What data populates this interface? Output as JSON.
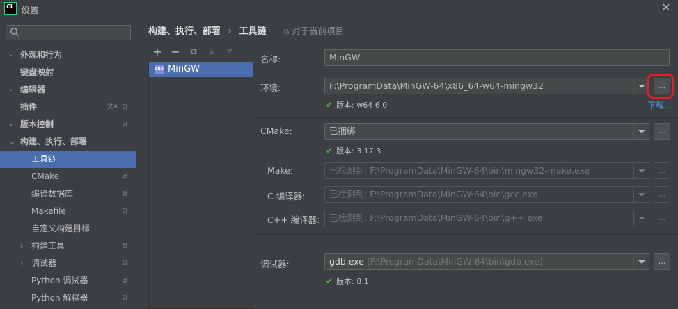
{
  "window": {
    "title": "设置",
    "app_logo": "CL",
    "close_icon": "✕"
  },
  "sidebar": {
    "search_placeholder": "",
    "items": [
      {
        "label": "外观和行为",
        "level": 0,
        "chevron": "›",
        "bold": true
      },
      {
        "label": "键盘映射",
        "level": 0,
        "chevron": "",
        "bold": true
      },
      {
        "label": "编辑器",
        "level": 0,
        "chevron": "›",
        "bold": true
      },
      {
        "label": "插件",
        "level": 0,
        "chevron": "",
        "bold": true
      },
      {
        "label": "版本控制",
        "level": 0,
        "chevron": "›",
        "bold": true
      },
      {
        "label": "构建、执行、部署",
        "level": 0,
        "chevron": "⌄",
        "bold": true
      },
      {
        "label": "工具链",
        "level": 1,
        "chevron": "",
        "selected": true
      },
      {
        "label": "CMake",
        "level": 1,
        "chevron": ""
      },
      {
        "label": "编译数据库",
        "level": 1,
        "chevron": ""
      },
      {
        "label": "Makefile",
        "level": 1,
        "chevron": ""
      },
      {
        "label": "自定义构建目标",
        "level": 1,
        "chevron": ""
      },
      {
        "label": "构建工具",
        "level": 1,
        "chevron": "›"
      },
      {
        "label": "调试器",
        "level": 1,
        "chevron": "›"
      },
      {
        "label": "Python 调试器",
        "level": 1,
        "chevron": ""
      },
      {
        "label": "Python 解释器",
        "level": 1,
        "chevron": ""
      }
    ]
  },
  "header": {
    "breadcrumb_parent": "构建、执行、部署",
    "breadcrumb_sep": "›",
    "breadcrumb_current": "工具链",
    "scope_label": "对于当前项目"
  },
  "toolbar": {
    "add": "+",
    "remove": "−",
    "copy": "⧉",
    "up": "▲",
    "down": "▼"
  },
  "toolchains": [
    {
      "name": "MinGW",
      "icon_text": "GNU"
    }
  ],
  "form": {
    "name_label": "名称:",
    "name_value": "MinGW",
    "env_label": "环境:",
    "env_value": "F:\\ProgramData\\MinGW-64\\x86_64-w64-mingw32",
    "env_version": "版本: w64 6.0",
    "download_link": "下载...",
    "cmake_label": "CMake:",
    "cmake_value": "已捆绑",
    "cmake_version": "版本: 3.17.3",
    "make_label": "Make:",
    "make_hint": "已检测到:",
    "make_value": "F:\\ProgramData\\MinGW-64\\bin\\mingw32-make.exe",
    "c_label": "C 编译器:",
    "c_hint": "已检测到:",
    "c_value": "F:\\ProgramData\\MinGW-64\\bin\\gcc.exe",
    "cpp_label": "C++ 编译器:",
    "cpp_hint": "已检测到:",
    "cpp_value": "F:\\ProgramData\\MinGW-64\\bin\\g++.exe",
    "debugger_label": "调试器:",
    "debugger_value": "gdb.exe",
    "debugger_path": "(F:\\ProgramData\\MinGW-64\\bin\\gdb.exe)",
    "debugger_version": "版本: 8.1",
    "browse_label": "...",
    "check_mark": "✔"
  },
  "colors": {
    "accent": "#4b6eaf",
    "highlight": "#e31e24",
    "check": "#5fb832",
    "link": "#589df6"
  }
}
